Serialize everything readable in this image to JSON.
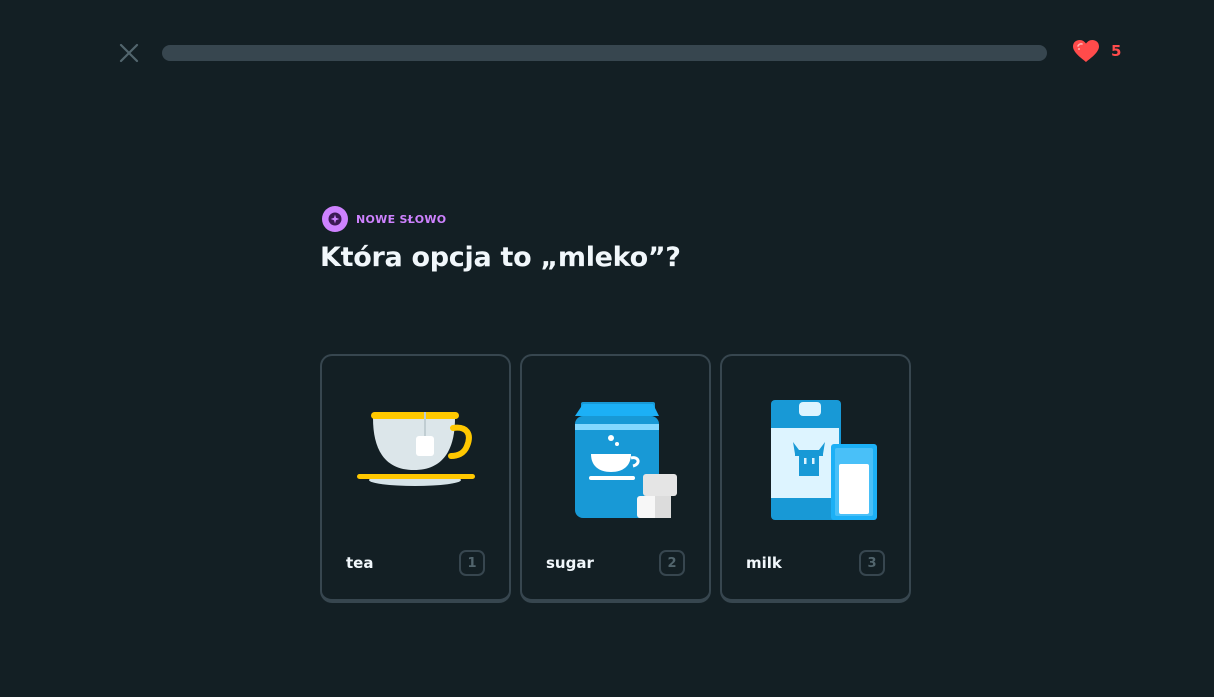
{
  "header": {
    "close_icon": "close-icon",
    "progress_fraction": 0.0,
    "progress_color": "#58cc02",
    "hearts_icon": "heart-icon",
    "hearts_count": "5"
  },
  "challenge": {
    "badge_icon": "new-word-icon",
    "badge_label": "NOWE SŁOWO",
    "question": "Która opcja to „mleko”?",
    "accent_color": "#ce82ff"
  },
  "choices": [
    {
      "label": "tea",
      "key": "1",
      "illustration": "teacup-icon"
    },
    {
      "label": "sugar",
      "key": "2",
      "illustration": "sugar-bag-icon"
    },
    {
      "label": "milk",
      "key": "3",
      "illustration": "milk-carton-icon"
    }
  ]
}
